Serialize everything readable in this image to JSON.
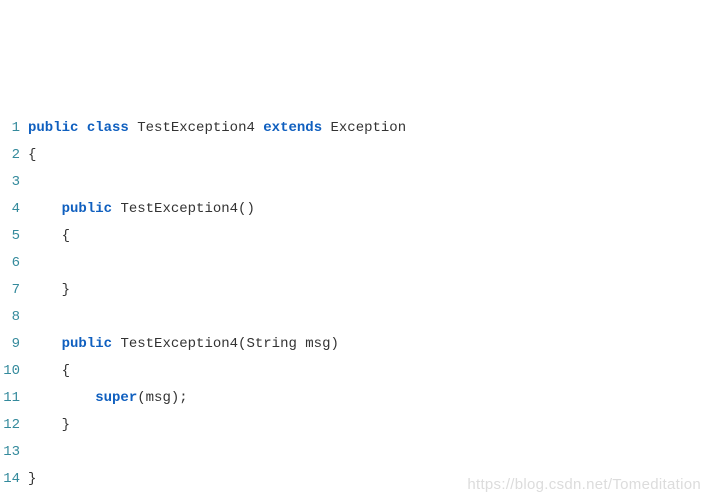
{
  "code": {
    "lines": [
      {
        "no": "1",
        "tokens": [
          {
            "t": "public",
            "c": "kw"
          },
          {
            "t": " ",
            "c": "plain"
          },
          {
            "t": "class",
            "c": "kw"
          },
          {
            "t": " ",
            "c": "plain"
          },
          {
            "t": "TestException4",
            "c": "plain"
          },
          {
            "t": " ",
            "c": "plain"
          },
          {
            "t": "extends",
            "c": "kw"
          },
          {
            "t": " ",
            "c": "plain"
          },
          {
            "t": "Exception",
            "c": "plain"
          }
        ]
      },
      {
        "no": "2",
        "tokens": [
          {
            "t": "{",
            "c": "plain"
          }
        ]
      },
      {
        "no": "3",
        "tokens": []
      },
      {
        "no": "4",
        "tokens": [
          {
            "t": "    ",
            "c": "plain"
          },
          {
            "t": "public",
            "c": "kw"
          },
          {
            "t": " ",
            "c": "plain"
          },
          {
            "t": "TestException4()",
            "c": "plain"
          }
        ]
      },
      {
        "no": "5",
        "tokens": [
          {
            "t": "    {",
            "c": "plain"
          }
        ]
      },
      {
        "no": "6",
        "tokens": []
      },
      {
        "no": "7",
        "tokens": [
          {
            "t": "    }",
            "c": "plain"
          }
        ]
      },
      {
        "no": "8",
        "tokens": []
      },
      {
        "no": "9",
        "tokens": [
          {
            "t": "    ",
            "c": "plain"
          },
          {
            "t": "public",
            "c": "kw"
          },
          {
            "t": " ",
            "c": "plain"
          },
          {
            "t": "TestException4(String msg)",
            "c": "plain"
          }
        ]
      },
      {
        "no": "10",
        "tokens": [
          {
            "t": "    {",
            "c": "plain"
          }
        ]
      },
      {
        "no": "11",
        "tokens": [
          {
            "t": "        ",
            "c": "plain"
          },
          {
            "t": "super",
            "c": "kw"
          },
          {
            "t": "(msg);",
            "c": "plain"
          }
        ]
      },
      {
        "no": "12",
        "tokens": [
          {
            "t": "    }",
            "c": "plain"
          }
        ]
      },
      {
        "no": "13",
        "tokens": []
      },
      {
        "no": "14",
        "tokens": [
          {
            "t": "}",
            "c": "plain"
          }
        ]
      }
    ]
  },
  "watermark": "https://blog.csdn.net/Tomeditation"
}
